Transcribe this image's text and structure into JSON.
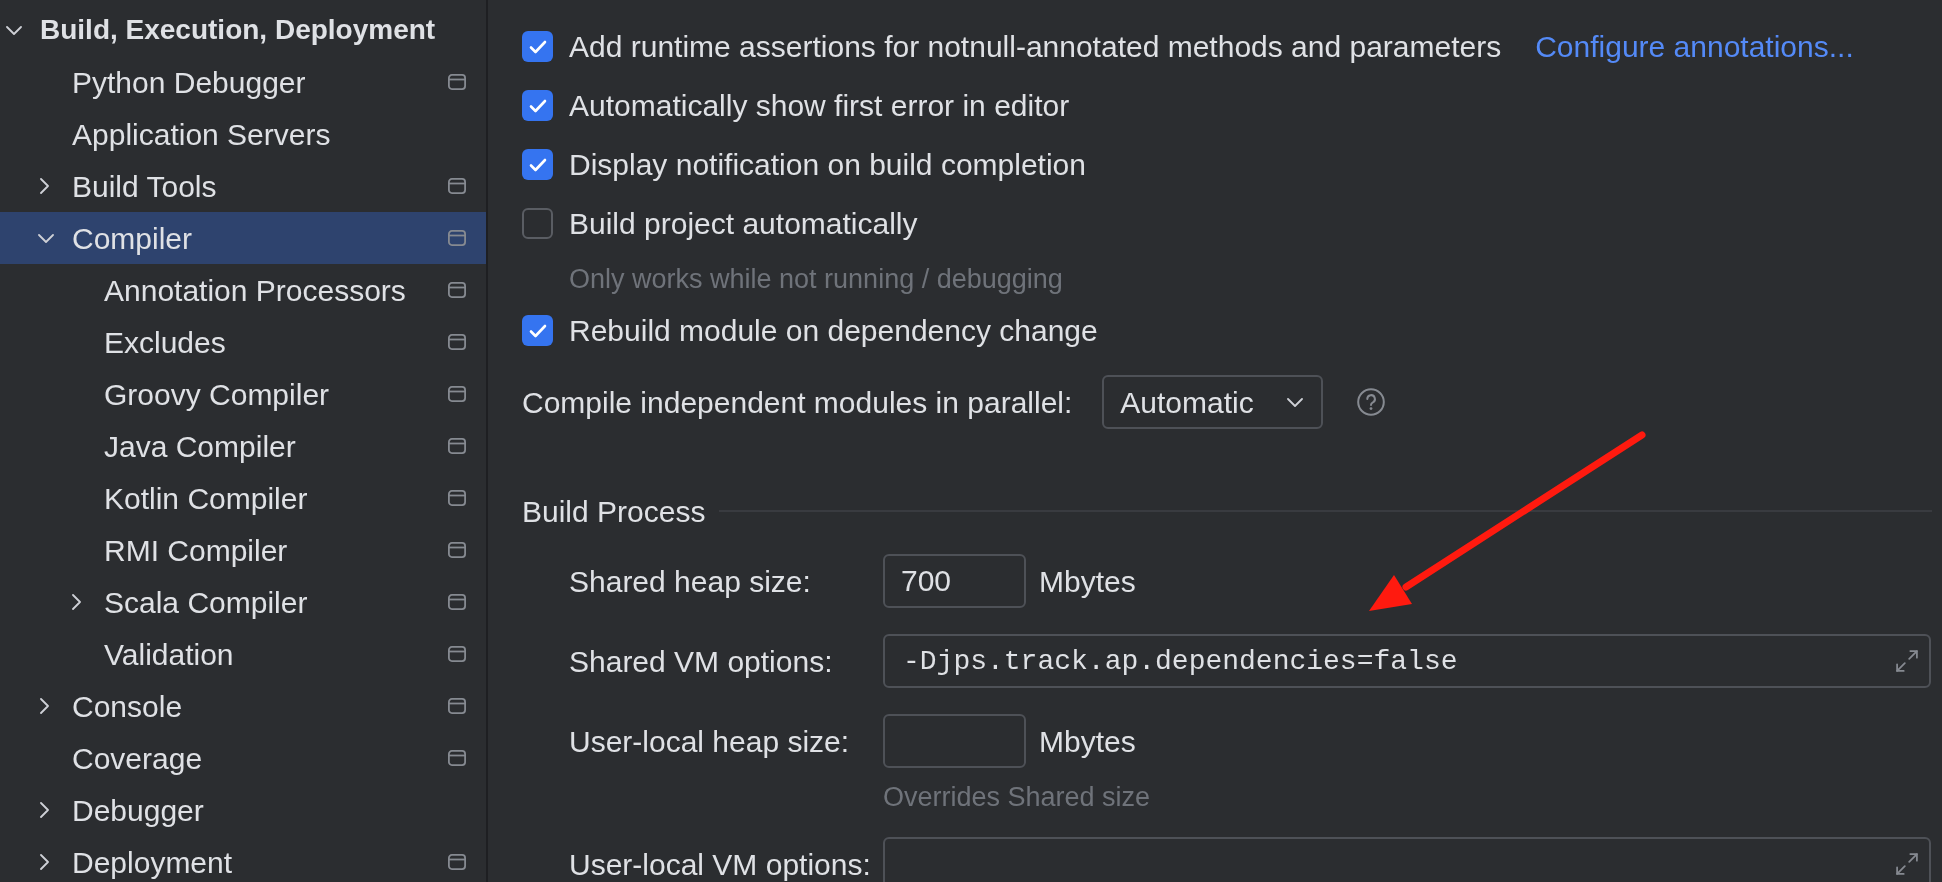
{
  "sidebar": {
    "tree": [
      {
        "label": "Build, Execution, Deployment",
        "expanded": true,
        "selected": false,
        "project_level": false,
        "children": [
          {
            "label": "Python Debugger",
            "selected": false,
            "project_level": true
          },
          {
            "label": "Application Servers",
            "selected": false,
            "project_level": false
          },
          {
            "label": "Build Tools",
            "expanded": false,
            "selected": false,
            "project_level": true
          },
          {
            "label": "Compiler",
            "expanded": true,
            "selected": true,
            "project_level": true,
            "children": [
              {
                "label": "Annotation Processors",
                "selected": false,
                "project_level": true
              },
              {
                "label": "Excludes",
                "selected": false,
                "project_level": true
              },
              {
                "label": "Groovy Compiler",
                "selected": false,
                "project_level": true
              },
              {
                "label": "Java Compiler",
                "selected": false,
                "project_level": true
              },
              {
                "label": "Kotlin Compiler",
                "selected": false,
                "project_level": true
              },
              {
                "label": "RMI Compiler",
                "selected": false,
                "project_level": true
              },
              {
                "label": "Scala Compiler",
                "expanded": false,
                "selected": false,
                "project_level": true
              },
              {
                "label": "Validation",
                "selected": false,
                "project_level": true
              }
            ]
          },
          {
            "label": "Console",
            "expanded": false,
            "selected": false,
            "project_level": true
          },
          {
            "label": "Coverage",
            "selected": false,
            "project_level": true
          },
          {
            "label": "Debugger",
            "expanded": false,
            "selected": false,
            "project_level": false
          },
          {
            "label": "Deployment",
            "expanded": false,
            "selected": false,
            "project_level": true
          }
        ]
      }
    ]
  },
  "options": [
    {
      "kind": "checkbox",
      "label": "Add runtime assertions for notnull-annotated methods and parameters",
      "checked": true,
      "link": "Configure annotations..."
    },
    {
      "kind": "checkbox",
      "label": "Automatically show first error in editor",
      "checked": true
    },
    {
      "kind": "checkbox",
      "label": "Display notification on build completion",
      "checked": true
    },
    {
      "kind": "checkbox",
      "label": "Build project automatically",
      "checked": false,
      "hint": "Only works while not running / debugging"
    },
    {
      "kind": "checkbox",
      "label": "Rebuild module on dependency change",
      "checked": true
    },
    {
      "kind": "dropdown",
      "label": "Compile independent modules in parallel:",
      "value": "Automatic"
    }
  ],
  "build_process": {
    "title": "Build Process",
    "fields": [
      {
        "kind": "number",
        "label": "Shared heap size:",
        "value": "700",
        "unit": "Mbytes"
      },
      {
        "kind": "text",
        "label": "Shared VM options:",
        "value": "-Djps.track.ap.dependencies=false"
      },
      {
        "kind": "number",
        "label": "User-local heap size:",
        "unit": "Mbytes",
        "hint": "Overrides Shared size"
      },
      {
        "kind": "text",
        "label": "User-local VM options:"
      }
    ]
  },
  "annotations": [
    {
      "kind": "arrow"
    }
  ]
}
